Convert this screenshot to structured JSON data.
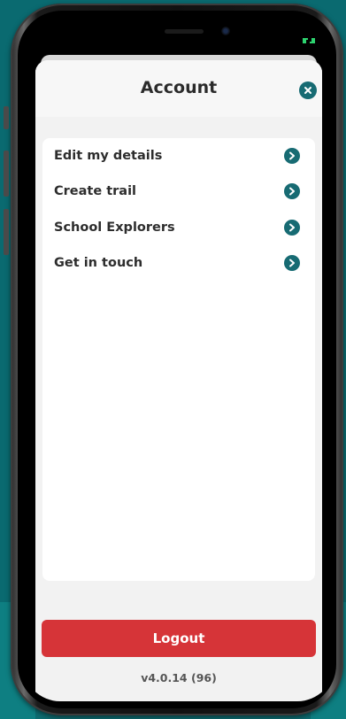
{
  "header": {
    "title": "Account",
    "close_icon": "close-icon"
  },
  "menu": {
    "items": [
      {
        "label": "Edit my details",
        "icon": "chevron-right-icon"
      },
      {
        "label": "Create trail",
        "icon": "chevron-right-icon"
      },
      {
        "label": "School Explorers",
        "icon": "chevron-right-icon"
      },
      {
        "label": "Get in touch",
        "icon": "chevron-right-icon"
      }
    ]
  },
  "footer": {
    "logout_label": "Logout",
    "version": "v4.0.14 (96)"
  },
  "colors": {
    "accent": "#176b73",
    "logout": "#d63438",
    "background": "#0d6b70",
    "battery": "#2dd36f"
  }
}
